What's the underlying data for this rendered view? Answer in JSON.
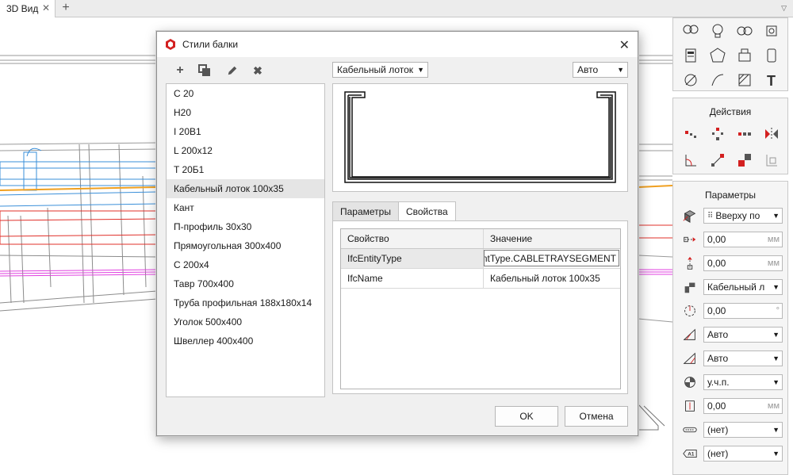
{
  "tab": {
    "title": "3D Вид",
    "close_glyph": "✕",
    "add_glyph": "+",
    "menu_glyph": "▽"
  },
  "dialog": {
    "title": "Стили балки",
    "close_glyph": "✕",
    "toolbar": {
      "add_glyph": "+",
      "copy_icon": "copy-icon",
      "edit_icon": "pencil-icon",
      "delete_glyph": "✖"
    },
    "styles": [
      "С 20",
      "H20",
      "I 20B1",
      "L 200x12",
      "T 20Б1",
      "Кабельный лоток 100x35",
      "Кант",
      "П-профиль 30x30",
      "Прямоугольная 300x400",
      "С 200x4",
      "Тавр 700x400",
      "Труба профильная 188x180x14",
      "Уголок 500x400",
      "Швеллер 400x400"
    ],
    "selected_index": 5,
    "profile_type": "Кабельный лоток",
    "size_mode": "Авто",
    "tabs": [
      "Параметры",
      "Свойства"
    ],
    "active_tab": "Свойства",
    "table": {
      "headers": [
        "Свойство",
        "Значение"
      ],
      "rows": [
        {
          "property": "IfcEntityType",
          "value": "mentType.CABLETRAYSEGMENT"
        },
        {
          "property": "IfcName",
          "value": "Кабельный лоток 100x35"
        }
      ]
    },
    "ok_label": "OK",
    "cancel_label": "Отмена"
  },
  "actions_panel": {
    "title": "Действия"
  },
  "params_panel": {
    "title": "Параметры",
    "rows": [
      {
        "icon": "justification-icon",
        "value": "Вверху по",
        "kind": "select",
        "prefix": "⠿"
      },
      {
        "icon": "horizontal-offset-icon",
        "value": "0,00",
        "kind": "number",
        "unit": "мм"
      },
      {
        "icon": "vertical-offset-icon",
        "value": "0,00",
        "kind": "number",
        "unit": "мм"
      },
      {
        "icon": "profile-icon",
        "value": "Кабельный л",
        "kind": "select"
      },
      {
        "icon": "rotation-icon",
        "value": "0,00",
        "kind": "number",
        "unit": "°"
      },
      {
        "icon": "start-cut-icon",
        "value": "Авто",
        "kind": "select"
      },
      {
        "icon": "end-cut-icon",
        "value": "Авто",
        "kind": "select"
      },
      {
        "icon": "material-icon",
        "value": "у.ч.п.",
        "kind": "select"
      },
      {
        "icon": "height-offset-icon",
        "value": "0,00",
        "kind": "number",
        "unit": "мм"
      },
      {
        "icon": "layer-icon",
        "value": "(нет)",
        "kind": "select"
      },
      {
        "icon": "label-icon",
        "value": "(нет)",
        "kind": "select",
        "badge": "A1"
      }
    ]
  },
  "colors": {
    "accent_red": "#d32020",
    "duct_blue": "#3a8fd9",
    "pipe_red": "#e0302a",
    "tray_magenta": "#e040e0",
    "tray_orange": "#f0a020"
  }
}
